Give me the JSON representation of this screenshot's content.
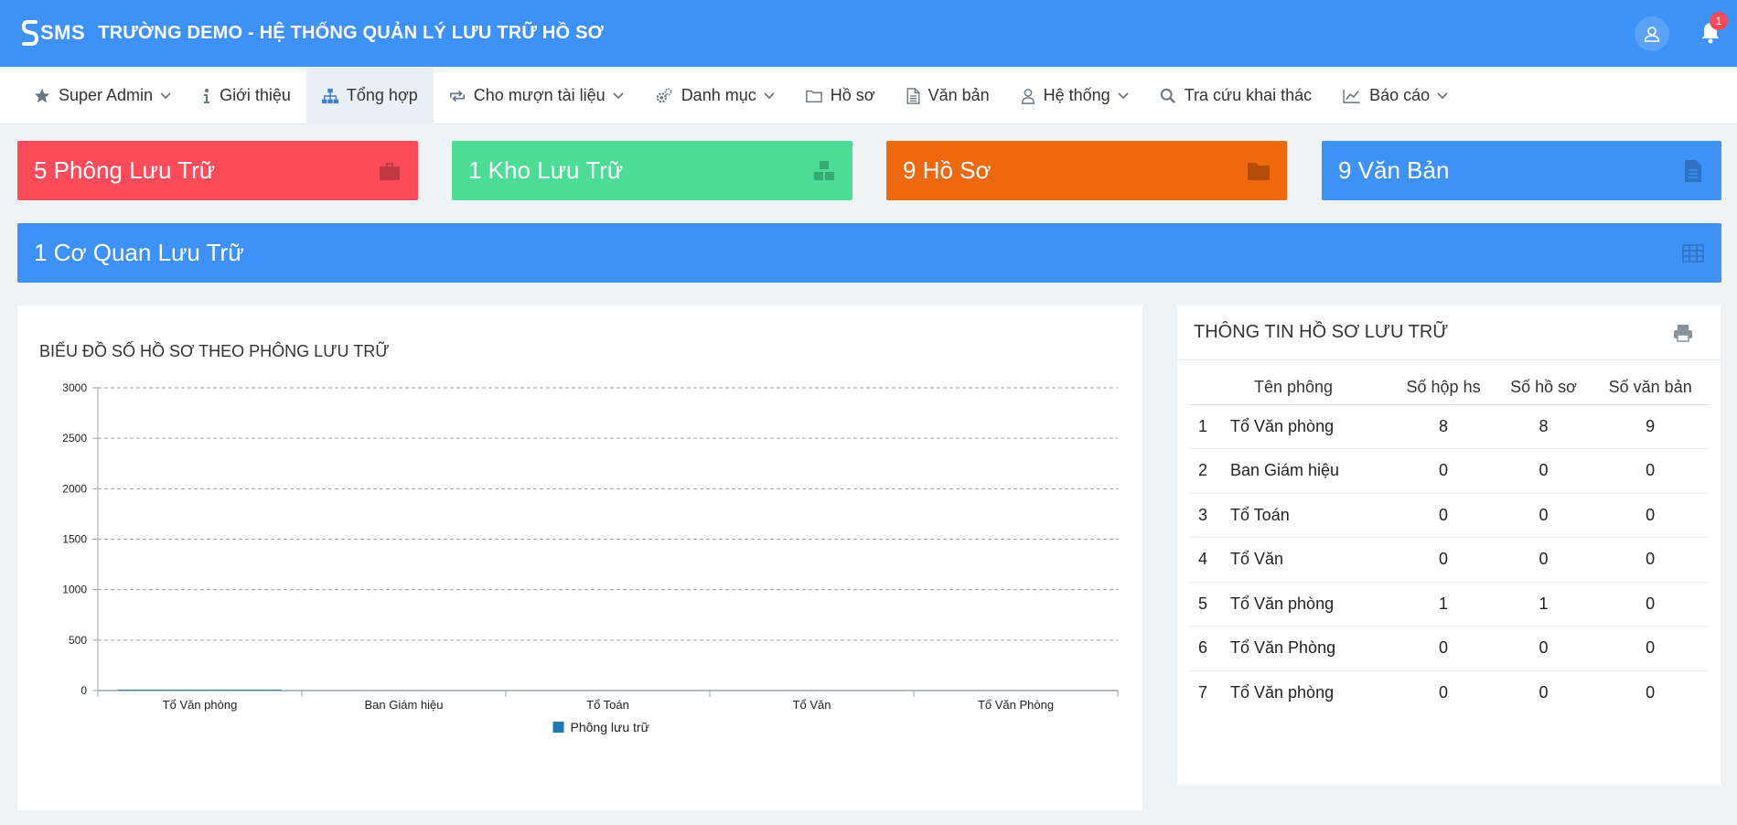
{
  "header": {
    "logo_text": "SMS",
    "title": "TRƯỜNG DEMO - HỆ THỐNG QUẢN LÝ LƯU TRỮ HỒ SƠ",
    "notification_count": "1",
    "accent": "#3e91f6"
  },
  "nav": {
    "items": [
      {
        "label": "Super Admin",
        "icon": "star-icon"
      },
      {
        "label": "Giới thiệu",
        "icon": "info-icon"
      },
      {
        "label": "Tổng hợp",
        "icon": "sitemap-icon",
        "active": true
      },
      {
        "label": "Cho mượn tài liệu",
        "icon": "exchange-icon"
      },
      {
        "label": "Danh mục",
        "icon": "cogs-icon"
      },
      {
        "label": "Hồ sơ",
        "icon": "folder-icon"
      },
      {
        "label": "Văn bản",
        "icon": "file-icon"
      },
      {
        "label": "Hệ thống",
        "icon": "user-icon"
      },
      {
        "label": "Tra cứu khai thác",
        "icon": "search-icon"
      },
      {
        "label": "Báo cáo",
        "icon": "line-chart-icon"
      }
    ]
  },
  "tiles": [
    {
      "label": "5 Phông Lưu Trữ",
      "color": "#fc4b5a",
      "icon": "briefcase-icon"
    },
    {
      "label": "1 Kho Lưu Trữ",
      "color": "#4cdc95",
      "icon": "cubes-icon"
    },
    {
      "label": "9 Hồ Sơ",
      "color": "#ee680d",
      "icon": "folder-icon"
    },
    {
      "label": "9 Văn Bản",
      "color": "#3e91f6",
      "icon": "file-text-icon"
    },
    {
      "label": "1 Cơ Quan Lưu Trữ",
      "color": "#3e91f6",
      "icon": "table-icon"
    }
  ],
  "chart": {
    "title": "BIỂU ĐỒ SỐ HỒ SƠ THEO PHÔNG LƯU TRỮ"
  },
  "chart_data": {
    "type": "bar",
    "title": "BIỂU ĐỒ SỐ HỒ SƠ THEO PHÔNG LƯU TRỮ",
    "categories": [
      "Tổ Văn phòng",
      "Ban Giám hiệu",
      "Tổ Toán",
      "Tổ Văn",
      "Tổ Văn Phòng"
    ],
    "series": [
      {
        "name": "Phông lưu trữ",
        "values": [
          8,
          0,
          0,
          0,
          0
        ],
        "color": "#1f77b4"
      }
    ],
    "ylim": [
      0,
      3000
    ],
    "yticks": [
      0,
      500,
      1000,
      1500,
      2000,
      2500,
      3000
    ],
    "grid": true,
    "legend": "bottom-center"
  },
  "info": {
    "title": "THÔNG TIN HỒ SƠ LƯU TRỮ",
    "columns": [
      "Tên phông",
      "Số hộp hs",
      "Số hồ sơ",
      "Số văn bản"
    ],
    "rows": [
      {
        "idx": "1",
        "name": "Tổ Văn phòng",
        "boxes": "8",
        "records": "8",
        "docs": "9"
      },
      {
        "idx": "2",
        "name": "Ban Giám hiệu",
        "boxes": "0",
        "records": "0",
        "docs": "0"
      },
      {
        "idx": "3",
        "name": "Tổ Toán",
        "boxes": "0",
        "records": "0",
        "docs": "0"
      },
      {
        "idx": "4",
        "name": "Tổ Văn",
        "boxes": "0",
        "records": "0",
        "docs": "0"
      },
      {
        "idx": "5",
        "name": "Tổ Văn phòng",
        "boxes": "1",
        "records": "1",
        "docs": "0"
      },
      {
        "idx": "6",
        "name": "Tổ Văn Phòng",
        "boxes": "0",
        "records": "0",
        "docs": "0"
      },
      {
        "idx": "7",
        "name": "Tổ Văn phòng",
        "boxes": "0",
        "records": "0",
        "docs": "0"
      }
    ]
  }
}
